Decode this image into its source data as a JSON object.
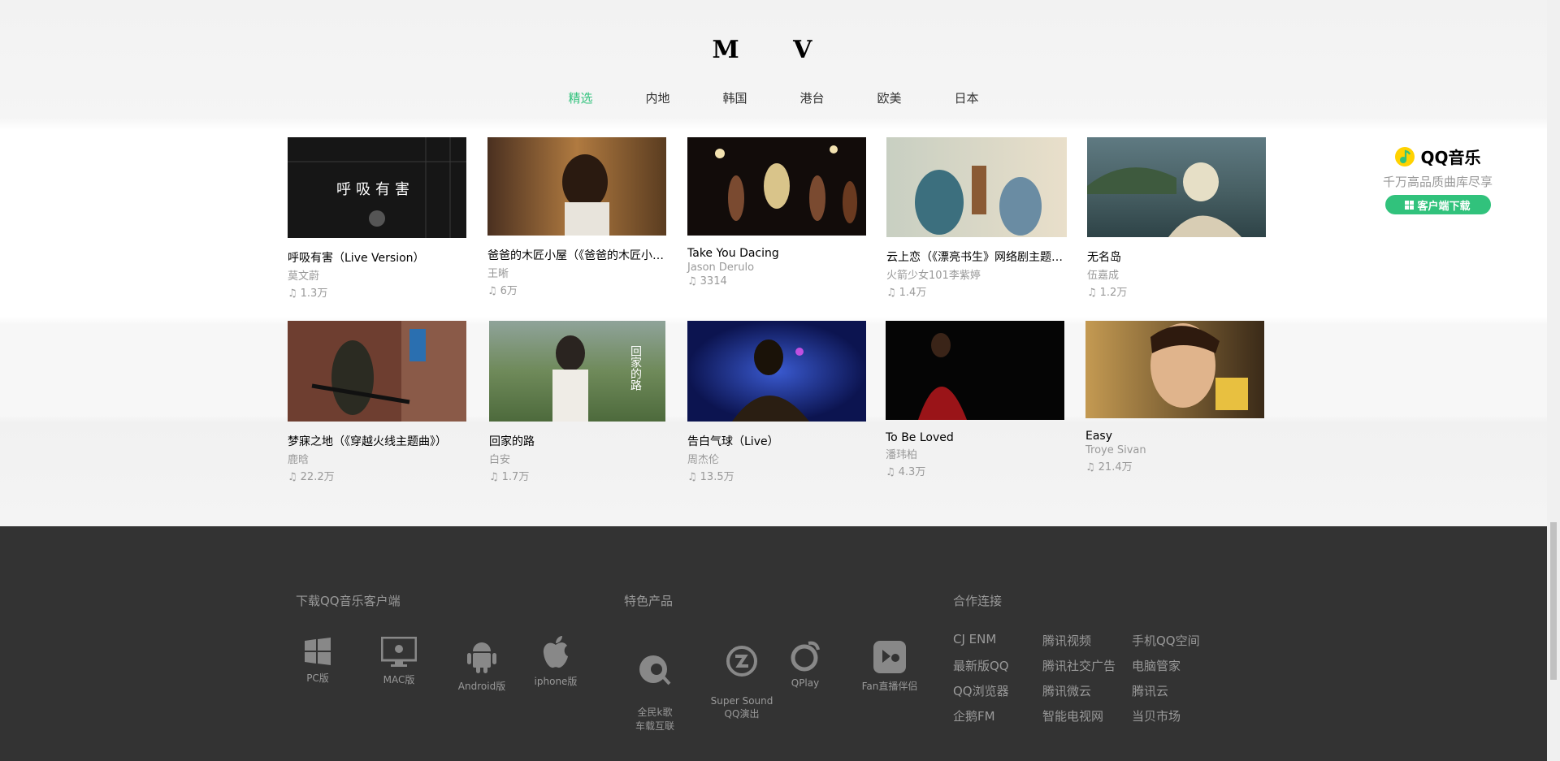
{
  "section": {
    "title": "M V"
  },
  "tabs": [
    "精选",
    "内地",
    "韩国",
    "港台",
    "欧美",
    "日本"
  ],
  "mv_rows": [
    [
      {
        "title": "呼吸有害（Live Version）",
        "singer": "莫文蔚",
        "plays": "1.3万",
        "thumb_text": "呼吸有害"
      },
      {
        "title": "爸爸的木匠小屋（《爸爸的木匠小屋》",
        "singer": "王晰",
        "plays": "6万"
      },
      {
        "title": "Take You Dacing",
        "singer": "Jason Derulo",
        "plays": "3314"
      },
      {
        "title": "云上恋（《漂亮书生》网络剧主题曲）",
        "singer": "火箭少女101李紫婷",
        "plays": "1.4万"
      },
      {
        "title": "无名岛",
        "singer": "伍嘉成",
        "plays": "1.2万"
      }
    ],
    [
      {
        "title": "梦寐之地（《穿越火线主题曲》）",
        "singer": "鹿晗",
        "plays": "22.2万"
      },
      {
        "title": "回家的路",
        "singer": "白安",
        "plays": "1.7万",
        "thumb_text": "回家的路"
      },
      {
        "title": "告白气球（Live）",
        "singer": "周杰伦",
        "plays": "13.5万"
      },
      {
        "title": "To Be Loved",
        "singer": "潘玮柏",
        "plays": "4.3万"
      },
      {
        "title": "Easy",
        "singer": "Troye Sivan",
        "plays": "21.4万"
      }
    ]
  ],
  "play_icon": "music-note-icon",
  "ad": {
    "logo_text": "QQ音乐",
    "slogan": "千万高品质曲库尽享",
    "button": "客户端下载"
  },
  "footer": {
    "download_title": "下载QQ音乐客户端",
    "downloads": [
      "PC版",
      "MAC版",
      "Android版",
      "iphone版"
    ],
    "products_title": "特色产品",
    "products": [
      "全民k歌\n车载互联",
      "Super Sound\nQQ演出",
      "QPlay",
      "Fan直播伴侣"
    ],
    "links_title": "合作连接",
    "links": [
      "CJ ENM",
      "腾讯视频",
      "手机QQ空间",
      "最新版QQ",
      "腾讯社交广告",
      "电脑管家",
      "QQ浏览器",
      "腾讯微云",
      "腾讯云",
      "企鹅FM",
      "智能电视网",
      "当贝市场"
    ]
  },
  "colors": {
    "accent": "#31c27c",
    "footer_bg": "#333333",
    "muted": "#999999"
  }
}
